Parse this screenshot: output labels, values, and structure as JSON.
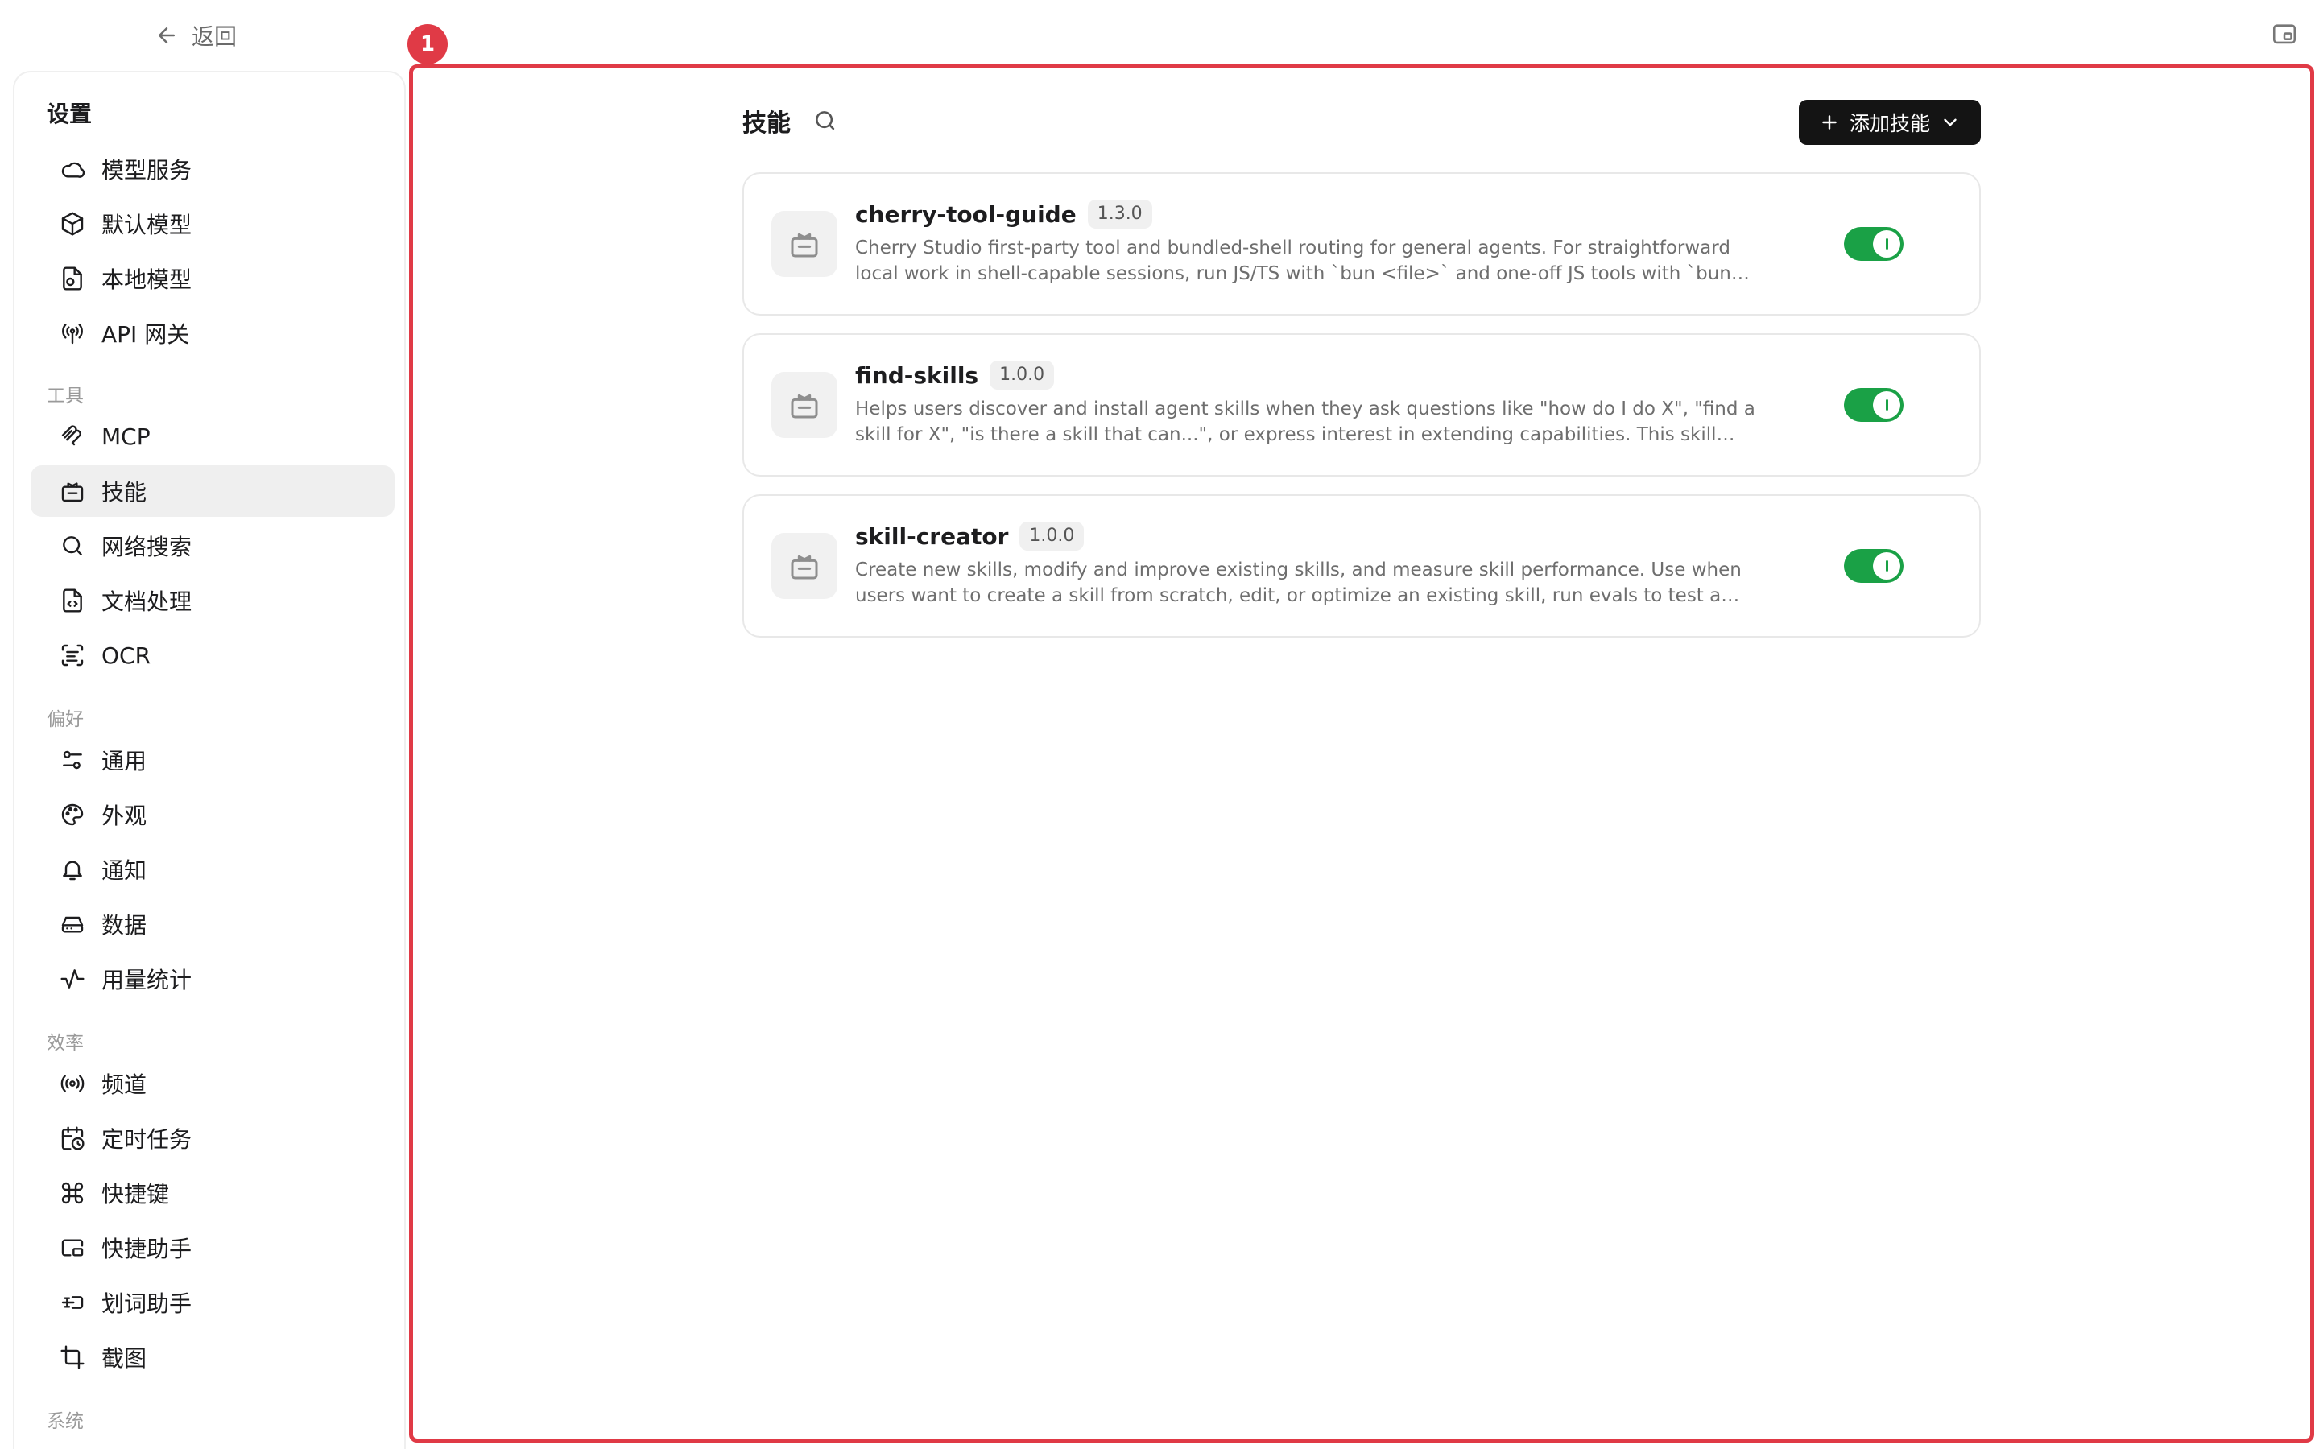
{
  "topbar": {
    "back_label": "返回"
  },
  "sidebar": {
    "title": "设置",
    "groups": [
      {
        "label": "",
        "items": [
          {
            "label": "模型服务",
            "icon": "cloud-icon"
          },
          {
            "label": "默认模型",
            "icon": "cube-icon"
          },
          {
            "label": "本地模型",
            "icon": "local-model-icon"
          },
          {
            "label": "API 网关",
            "icon": "antenna-icon"
          }
        ]
      },
      {
        "label": "工具",
        "items": [
          {
            "label": "MCP",
            "icon": "mcp-icon"
          },
          {
            "label": "技能",
            "icon": "skill-icon",
            "active": true
          },
          {
            "label": "网络搜索",
            "icon": "search-icon"
          },
          {
            "label": "文档处理",
            "icon": "document-icon"
          },
          {
            "label": "OCR",
            "icon": "scan-text-icon"
          }
        ]
      },
      {
        "label": "偏好",
        "items": [
          {
            "label": "通用",
            "icon": "sliders-icon"
          },
          {
            "label": "外观",
            "icon": "palette-icon"
          },
          {
            "label": "通知",
            "icon": "bell-icon"
          },
          {
            "label": "数据",
            "icon": "drive-icon"
          },
          {
            "label": "用量统计",
            "icon": "activity-icon"
          }
        ]
      },
      {
        "label": "效率",
        "items": [
          {
            "label": "频道",
            "icon": "broadcast-icon"
          },
          {
            "label": "定时任务",
            "icon": "calendar-clock-icon"
          },
          {
            "label": "快捷键",
            "icon": "command-icon"
          },
          {
            "label": "快捷助手",
            "icon": "assistant-window-icon"
          },
          {
            "label": "划词助手",
            "icon": "text-select-icon"
          },
          {
            "label": "截图",
            "icon": "crop-icon"
          }
        ]
      },
      {
        "label": "系统",
        "items": []
      }
    ]
  },
  "annotation": {
    "marker": "1"
  },
  "main": {
    "title": "技能",
    "add_button_label": "添加技能",
    "skills": [
      {
        "name": "cherry-tool-guide",
        "version": "1.3.0",
        "description": "Cherry Studio first-party tool and bundled-shell routing for general agents. For straightforward local work in shell-capable sessions, run JS/TS with `bun <file>` and one-off JS tools with `bun x`; run Python with `uv run ...",
        "enabled": true
      },
      {
        "name": "find-skills",
        "version": "1.0.0",
        "description": "Helps users discover and install agent skills when they ask questions like \"how do I do X\", \"find a skill for X\", \"is there a skill that can...\", or express interest in extending capabilities. This skill should be used when the user i...",
        "enabled": true
      },
      {
        "name": "skill-creator",
        "version": "1.0.0",
        "description": "Create new skills, modify and improve existing skills, and measure skill performance. Use when users want to create a skill from scratch, edit, or optimize an existing skill, run evals to test a skill, benchmark skill...",
        "enabled": true
      }
    ]
  },
  "colors": {
    "accent_toggle": "#1aa146",
    "annotation_red": "#e03a46",
    "primary_button": "#141414"
  }
}
